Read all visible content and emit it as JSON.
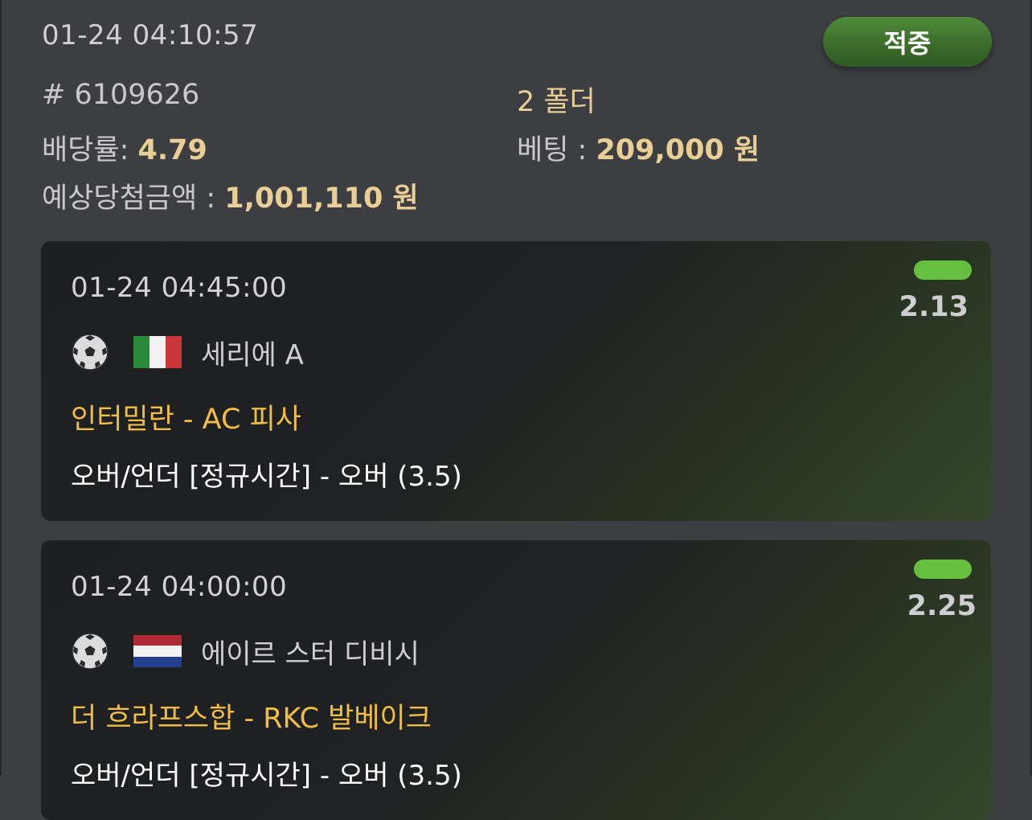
{
  "bet": {
    "placed_at": "01-24 04:10:57",
    "status_label": "적중",
    "ticket": "# 6109626",
    "folder_label": "2 폴더",
    "odds_label": "배당률: ",
    "odds_value": "4.79",
    "stake_label": "베팅 :  ",
    "stake_value": "209,000 원",
    "payout_label": "예상당첨금액 : ",
    "payout_value": "1,001,110 원"
  },
  "selections": [
    {
      "kickoff": "01-24 04:45:00",
      "sport_icon": "soccer-ball-icon",
      "country_flag": "italy-flag",
      "league": "세리에 A",
      "match": "인터밀란 - AC 피사",
      "pick": "오버/언더 [정규시간] - 오버 (3.5)",
      "odds": "2.13",
      "result_color": "#66bf3e"
    },
    {
      "kickoff": "01-24 04:00:00",
      "sport_icon": "soccer-ball-icon",
      "country_flag": "netherlands-flag",
      "league": "에이르 스터 디비시",
      "match": "더 흐라프스합 - RKC 발베이크",
      "pick": "오버/언더 [정규시간] - 오버 (3.5)",
      "odds": "2.25",
      "result_color": "#66bf3e"
    }
  ],
  "colors": {
    "background": "#3d3e42",
    "card": "#1e1f22",
    "accent_gold": "#e9cf95",
    "match_yellow": "#f1bd45",
    "win_green": "#66bf3e"
  }
}
